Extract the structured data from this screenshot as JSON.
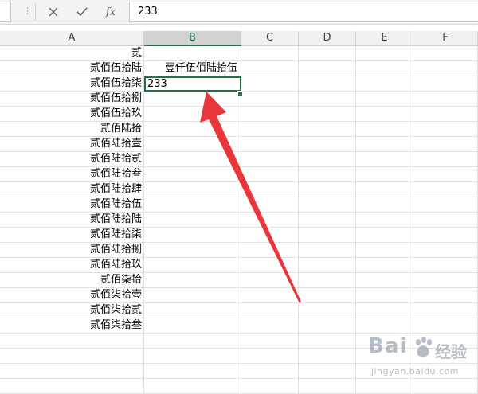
{
  "formula_bar": {
    "cancel_icon": "cancel-icon",
    "enter_icon": "checkmark-icon",
    "fx_label": "fx",
    "formula_value": "233"
  },
  "columns": [
    {
      "label": "A"
    },
    {
      "label": "B",
      "selected": true
    },
    {
      "label": "C"
    },
    {
      "label": "D"
    },
    {
      "label": "E"
    },
    {
      "label": "F"
    }
  ],
  "cells": {
    "A": [
      "贰",
      "贰佰伍拾陆",
      "贰佰伍拾柒",
      "贰佰伍拾捌",
      "贰佰伍拾玖",
      "贰佰陆拾",
      "贰佰陆拾壹",
      "贰佰陆拾贰",
      "贰佰陆拾叁",
      "贰佰陆拾肆",
      "贰佰陆拾伍",
      "贰佰陆拾陆",
      "贰佰陆拾柒",
      "贰佰陆拾捌",
      "贰佰陆拾玖",
      "贰佰柒拾",
      "贰佰柒拾壹",
      "贰佰柒拾贰",
      "贰佰柒拾叁"
    ],
    "B": [
      "",
      "壹仟伍佰陆拾伍",
      "233"
    ]
  },
  "active_cell": {
    "column": "B",
    "row_index": 2
  },
  "annotation_color": "#e8363a",
  "selection_color": "#217346",
  "watermark": {
    "brand": "Bai",
    "brand_cn": "经验",
    "url": "jingyan.baidu.com"
  }
}
